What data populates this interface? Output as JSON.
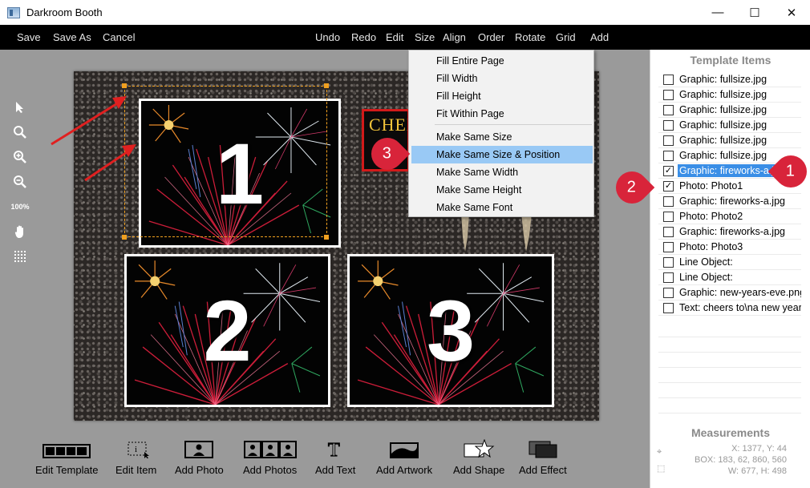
{
  "window": {
    "title": "Darkroom Booth",
    "minimize": "—",
    "maximize": "☐",
    "close": "✕"
  },
  "menubar": {
    "left": [
      "Save",
      "Save As",
      "Cancel"
    ],
    "right": [
      "Undo",
      "Redo",
      "Edit",
      "Size",
      "Align",
      "Order",
      "Rotate",
      "Grid",
      "Add"
    ]
  },
  "size_menu": {
    "items": [
      "Fill Entire Page",
      "Fill Width",
      "Fill Height",
      "Fit Within Page",
      "Make Same Size",
      "Make Same Size & Position",
      "Make Same Width",
      "Make Same Height",
      "Make Same Font"
    ],
    "highlighted": "Make Same Size & Position"
  },
  "tools": {
    "zoom_level": "100%"
  },
  "canvas": {
    "photo_numbers": [
      "1",
      "2",
      "3"
    ],
    "cheers_text": "CHEER"
  },
  "template_items": {
    "title": "Template Items",
    "items": [
      {
        "label": "Graphic: fullsize.jpg",
        "checked": false
      },
      {
        "label": "Graphic: fullsize.jpg",
        "checked": false
      },
      {
        "label": "Graphic: fullsize.jpg",
        "checked": false
      },
      {
        "label": "Graphic: fullsize.jpg",
        "checked": false
      },
      {
        "label": "Graphic: fullsize.jpg",
        "checked": false
      },
      {
        "label": "Graphic: fullsize.jpg",
        "checked": false
      },
      {
        "label": "Graphic: fireworks-a.jpg",
        "checked": true,
        "selected": true
      },
      {
        "label": "Photo: Photo1",
        "checked": true
      },
      {
        "label": "Graphic: fireworks-a.jpg",
        "checked": false
      },
      {
        "label": "Photo: Photo2",
        "checked": false
      },
      {
        "label": "Graphic: fireworks-a.jpg",
        "checked": false
      },
      {
        "label": "Photo: Photo3",
        "checked": false
      },
      {
        "label": "Line Object:",
        "checked": false
      },
      {
        "label": "Line Object:",
        "checked": false
      },
      {
        "label": "Graphic: new-years-eve.png",
        "checked": false
      },
      {
        "label": "Text: cheers to\\na new year!",
        "checked": false
      }
    ]
  },
  "measurements": {
    "title": "Measurements",
    "xy": "X: 1377, Y: 44",
    "box": "BOX: 183, 62, 860, 560",
    "wh": "W: 677, H: 498"
  },
  "bottom_toolbar": [
    "Edit Template",
    "Edit Item",
    "Add Photo",
    "Add Photos",
    "Add Text",
    "Add Artwork",
    "Add Shape",
    "Add Effect"
  ],
  "callouts": [
    "1",
    "2",
    "3"
  ],
  "colors": {
    "menubar": "#000000",
    "workspace": "#9a9a9a",
    "highlight": "#99c9f5",
    "selection": "#3a8ee6",
    "callout": "#d8243a",
    "guide_arrow": "#e02020"
  }
}
